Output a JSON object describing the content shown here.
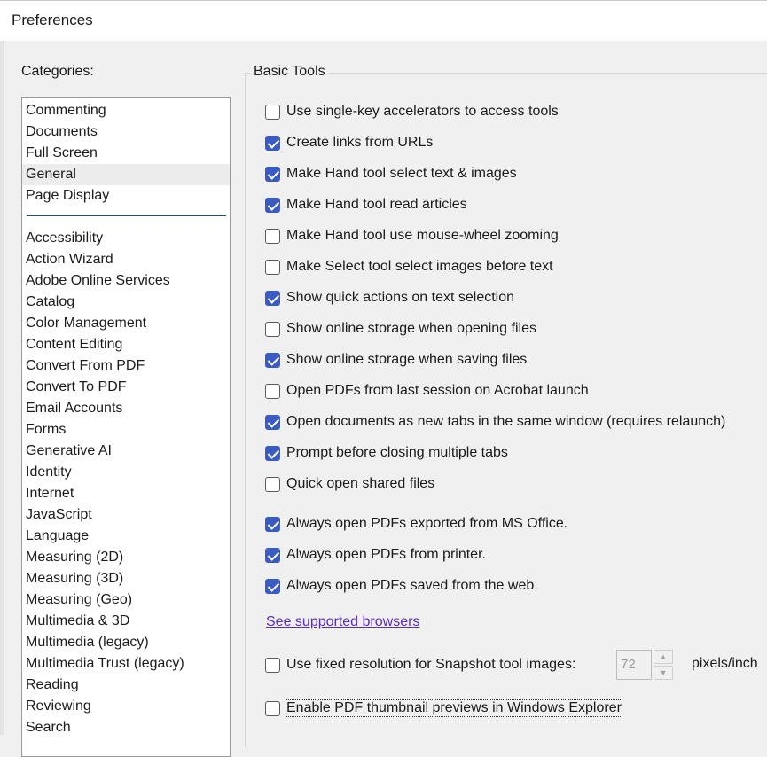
{
  "window": {
    "title": "Preferences"
  },
  "categories": {
    "label": "Categories:",
    "top_items": [
      "Commenting",
      "Documents",
      "Full Screen",
      "General",
      "Page Display"
    ],
    "selected": "General",
    "items": [
      "Accessibility",
      "Action Wizard",
      "Adobe Online Services",
      "Catalog",
      "Color Management",
      "Content Editing",
      "Convert From PDF",
      "Convert To PDF",
      "Email Accounts",
      "Forms",
      "Generative AI",
      "Identity",
      "Internet",
      "JavaScript",
      "Language",
      "Measuring (2D)",
      "Measuring (3D)",
      "Measuring (Geo)",
      "Multimedia & 3D",
      "Multimedia (legacy)",
      "Multimedia Trust (legacy)",
      "Reading",
      "Reviewing",
      "Search"
    ]
  },
  "basic_tools": {
    "label": "Basic Tools",
    "options": [
      {
        "label": "Use single-key accelerators to access tools",
        "checked": false
      },
      {
        "label": "Create links from URLs",
        "checked": true
      },
      {
        "label": "Make Hand tool select text & images",
        "checked": true
      },
      {
        "label": "Make Hand tool read articles",
        "checked": true
      },
      {
        "label": "Make Hand tool use mouse-wheel zooming",
        "checked": false
      },
      {
        "label": "Make Select tool select images before text",
        "checked": false
      },
      {
        "label": "Show quick actions on text selection",
        "checked": true
      },
      {
        "label": "Show online storage when opening files",
        "checked": false
      },
      {
        "label": "Show online storage when saving files",
        "checked": true
      },
      {
        "label": "Open PDFs from last session on Acrobat launch",
        "checked": false
      },
      {
        "label": "Open documents as new tabs in the same window (requires relaunch)",
        "checked": true
      },
      {
        "label": "Prompt before closing multiple tabs",
        "checked": true
      },
      {
        "label": "Quick open shared files",
        "checked": false
      },
      {
        "label": "Always open PDFs exported from MS Office.",
        "checked": true
      },
      {
        "label": "Always open PDFs from printer.",
        "checked": true
      },
      {
        "label": "Always open PDFs saved from the web.",
        "checked": true
      }
    ],
    "link": "See supported browsers",
    "snapshot": {
      "label": "Use fixed resolution for Snapshot tool images:",
      "checked": false,
      "value": "72",
      "unit": "pixels/inch"
    },
    "thumbnail": {
      "label": "Enable PDF thumbnail previews in Windows Explorer",
      "checked": false
    }
  },
  "colors": {
    "accent": "#3a5cc2",
    "link": "#5b2dc4",
    "selected_row": "#ececec"
  }
}
